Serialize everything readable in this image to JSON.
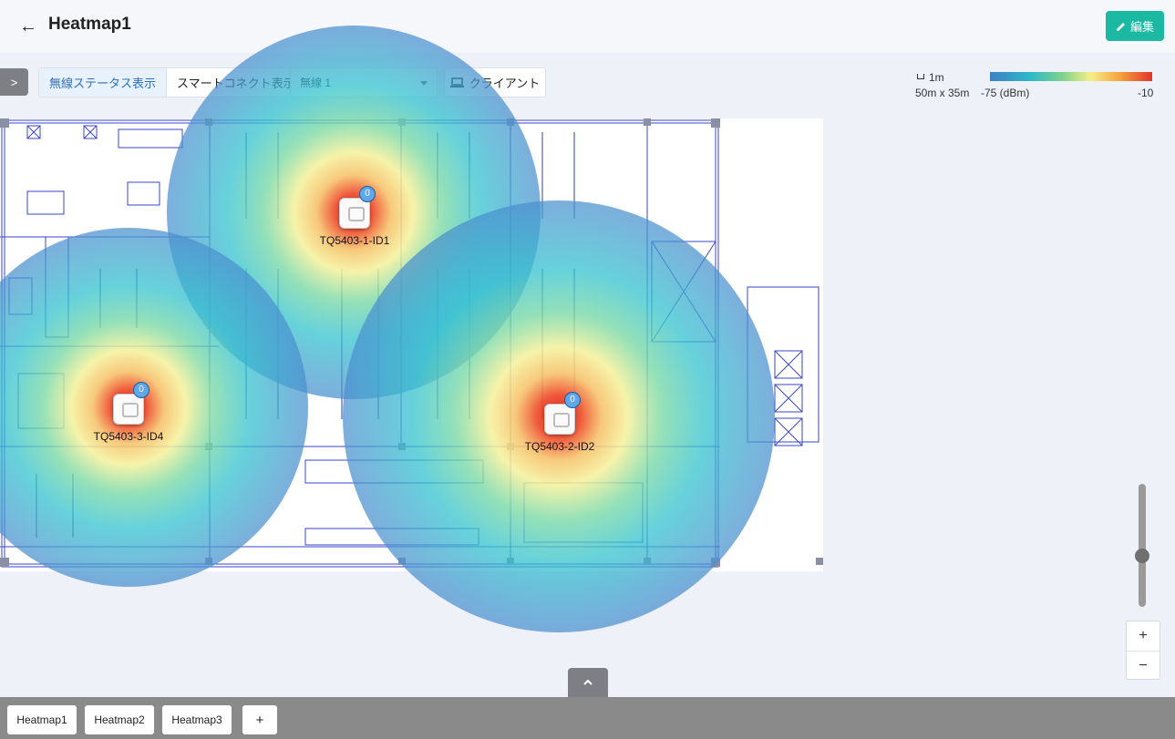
{
  "header": {
    "back_icon": "arrow-left-icon",
    "title": "Heatmap1",
    "edit_label": "編集",
    "edit_icon": "pencil-icon",
    "edit_color": "#1cb9a2"
  },
  "toolbar": {
    "wireless_status_label": "無線ステータス表示",
    "smart_connect_label": "スマートコネクト表示",
    "select_value": "無線 1",
    "client_label": "クライアント",
    "client_icon": "laptop-icon"
  },
  "legend": {
    "scale": "1m",
    "dimensions": "50m x 35m",
    "min": "-75 (dBm)",
    "max": "-10"
  },
  "access_points": [
    {
      "name": "TQ5403-1-ID1",
      "clients": "0"
    },
    {
      "name": "TQ5403-2-ID2",
      "clients": "0"
    },
    {
      "name": "TQ5403-3-ID4",
      "clients": "0"
    }
  ],
  "zoom": {
    "in": "+",
    "out": "−",
    "level": 0.45
  },
  "tabs": [
    "Heatmap1",
    "Heatmap2",
    "Heatmap3",
    "+"
  ]
}
